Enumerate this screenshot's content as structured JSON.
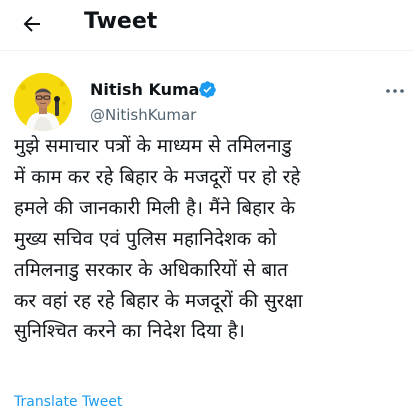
{
  "header": {
    "title": "Tweet",
    "back_icon": "arrow-left-icon"
  },
  "tweet": {
    "author": {
      "name": "Nitish Kumar",
      "handle": "@NitishKumar",
      "verified": true,
      "verified_icon": "verified-badge-icon",
      "avatar_background": "#f5d90a"
    },
    "more_icon": "more-options-icon",
    "text": "मुझे समाचार पत्रों के माध्यम से तमिलनाडु\nमें काम कर रहे बिहार के मजदूरों पर हो रहे\nहमले की जानकारी मिली है। मैंने बिहार के\nमुख्य सचिव एवं पुलिस महानिदेशक को\nतमिलनाडु सरकार के अधिकारियों से बात\nकर वहां रह रहे बिहार के मजदूरों की सुरक्षा\nसुनिश्चित करने का निदेश दिया है।",
    "translate_label": "Translate Tweet"
  },
  "colors": {
    "text_primary": "#0f1419",
    "text_secondary": "#536471",
    "accent": "#1d9bf0",
    "divider": "#eff3f4"
  }
}
